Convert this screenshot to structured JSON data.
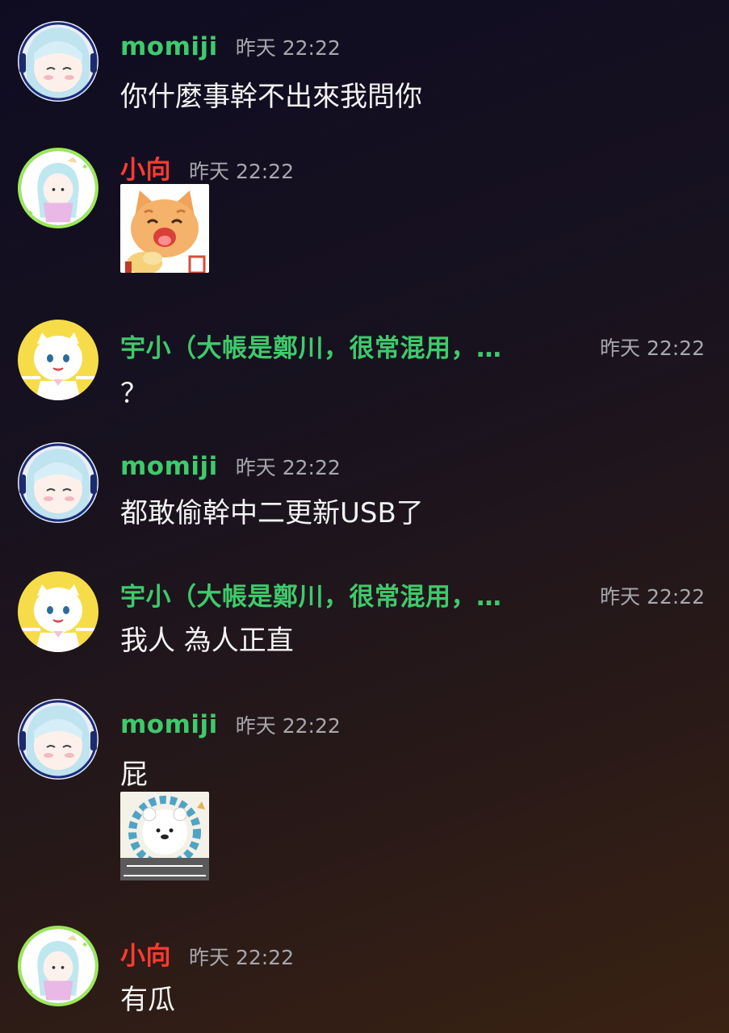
{
  "messages": [
    {
      "user": "momiji",
      "time": "昨天 22:22",
      "text": "你什麼事幹不出來我問你"
    },
    {
      "user": "小向",
      "time": "昨天 22:22",
      "sticker": "cat-eating-sticker"
    },
    {
      "user": "宇小（大帳是鄭川，很常混用，…",
      "time": "昨天 22:22",
      "text": "？"
    },
    {
      "user": "momiji",
      "time": "昨天 22:22",
      "text": "都敢偷幹中二更新USB了"
    },
    {
      "user": "宇小（大帳是鄭川，很常混用，…",
      "time": "昨天 22:22",
      "text": "我人 為人正直"
    },
    {
      "user": "momiji",
      "time": "昨天 22:22",
      "text": "屁",
      "sticker": "world-vanquisher-bear-sticker"
    },
    {
      "user": "小向",
      "time": "昨天 22:22",
      "text": "有瓜"
    }
  ],
  "colors": {
    "name_green": "#3fca6b",
    "name_red": "#ff3b30",
    "timestamp": "#a7a7ad",
    "avatar_ring": "#9be85a"
  }
}
